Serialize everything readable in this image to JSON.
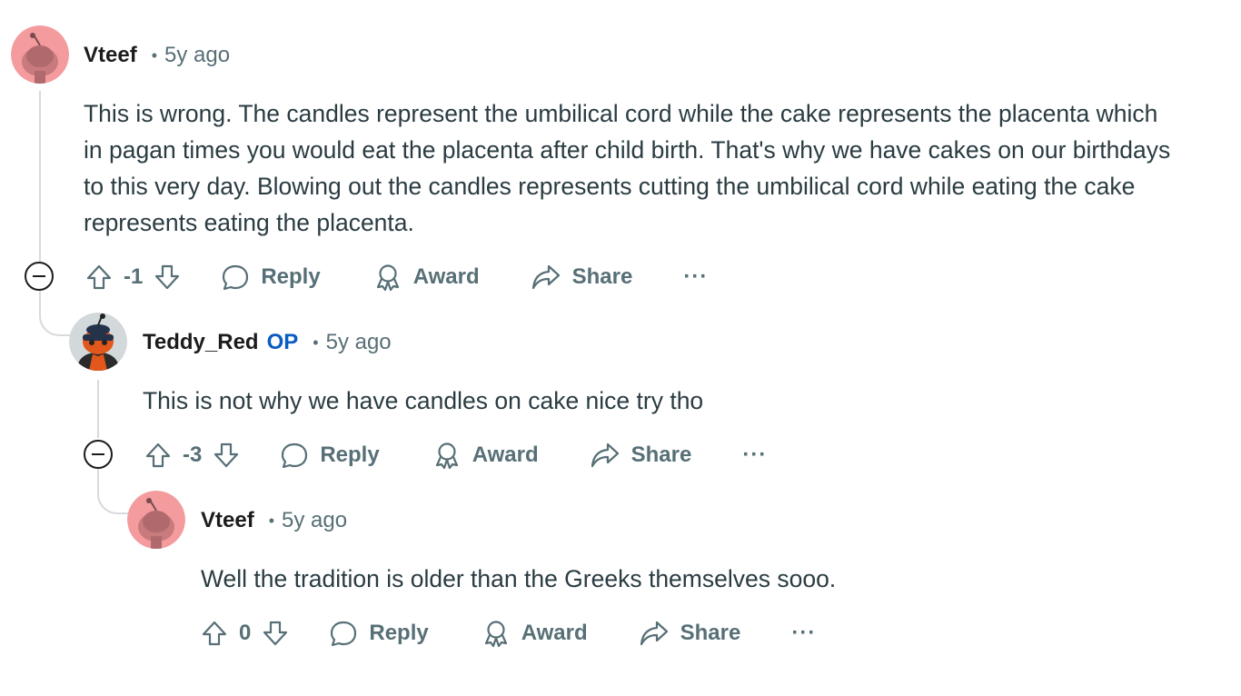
{
  "comments": [
    {
      "username": "Vteef",
      "op_badge": "",
      "separator": "•",
      "time": "5y ago",
      "body": "This is wrong. The candles represent the umbilical cord while the cake represents the placenta which in pagan times you would eat the placenta after child birth. That's why we have cakes on our birthdays to this very day. Blowing out the candles represents cutting the umbilical cord while eating the cake represents eating the placenta.",
      "score": "-1",
      "reply_label": "Reply",
      "award_label": "Award",
      "share_label": "Share",
      "more_label": "···",
      "avatar_color": "#f49b9e"
    },
    {
      "username": "Teddy_Red",
      "op_badge": "OP",
      "separator": "•",
      "time": "5y ago",
      "body": "This is not why we have candles on cake nice try tho",
      "score": "-3",
      "reply_label": "Reply",
      "award_label": "Award",
      "share_label": "Share",
      "more_label": "···",
      "avatar_color": "#d3d8db"
    },
    {
      "username": "Vteef",
      "op_badge": "",
      "separator": "•",
      "time": "5y ago",
      "body": "Well the tradition is older than the Greeks themselves sooo.",
      "score": "0",
      "reply_label": "Reply",
      "award_label": "Award",
      "share_label": "Share",
      "more_label": "···",
      "avatar_color": "#f49b9e"
    }
  ],
  "icons": {
    "upvote": "upvote-icon",
    "downvote": "downvote-icon",
    "reply": "speech-bubble-icon",
    "award": "award-ribbon-icon",
    "share": "share-arrow-icon",
    "collapse": "collapse-minus-icon"
  },
  "colors": {
    "op_badge": "#0a5cc2",
    "meta_text": "#576f76",
    "body_text": "#2a3c42",
    "thread_line": "#d7dadc"
  }
}
